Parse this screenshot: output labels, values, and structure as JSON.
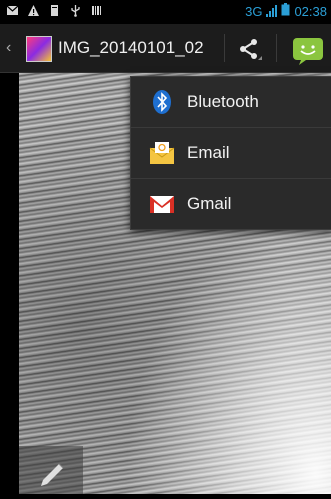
{
  "status_bar": {
    "network": "3G",
    "time": "02:38"
  },
  "action_bar": {
    "title": "IMG_20140101_02"
  },
  "share_menu": {
    "items": [
      {
        "label": "Bluetooth",
        "icon": "bluetooth-icon"
      },
      {
        "label": "Email",
        "icon": "email-icon"
      },
      {
        "label": "Gmail",
        "icon": "gmail-icon"
      }
    ]
  },
  "colors": {
    "status_accent": "#2b9fd6",
    "messaging_green": "#8bc53f",
    "menu_bg": "#2a2a2a"
  }
}
